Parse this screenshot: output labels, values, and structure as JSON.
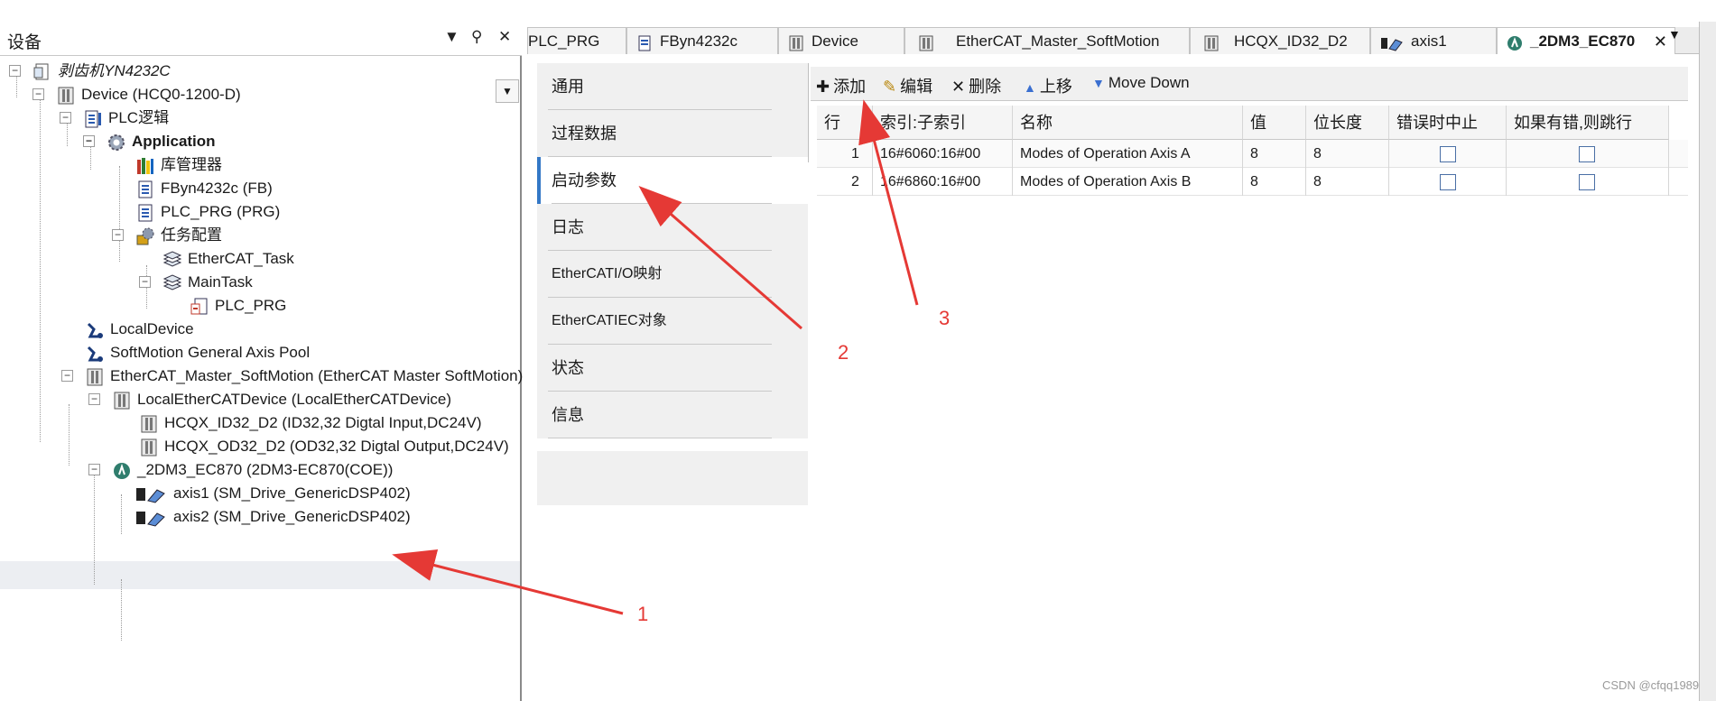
{
  "device_pane": {
    "title": "设备",
    "buttons": [
      "▼",
      "⚲",
      "✕"
    ],
    "tree": [
      {
        "label": "剥齿机YN4232C",
        "icon": "project-icon"
      },
      {
        "label": "Device (HCQ0-1200-D)",
        "icon": "device-icon"
      },
      {
        "label": "PLC逻辑",
        "icon": "plc-logic-icon"
      },
      {
        "label": "Application",
        "icon": "application-gear-icon"
      },
      {
        "label": "库管理器",
        "icon": "library-manager-icon"
      },
      {
        "label": "FByn4232c (FB)",
        "icon": "pou-icon"
      },
      {
        "label": "PLC_PRG (PRG)",
        "icon": "pou-icon"
      },
      {
        "label": "任务配置",
        "icon": "task-config-icon"
      },
      {
        "label": "EtherCAT_Task",
        "icon": "task-icon"
      },
      {
        "label": "MainTask",
        "icon": "task-icon"
      },
      {
        "label": "PLC_PRG",
        "icon": "program-call-icon"
      },
      {
        "label": "LocalDevice",
        "icon": "local-device-icon"
      },
      {
        "label": "SoftMotion General Axis Pool",
        "icon": "axis-pool-icon"
      },
      {
        "label": "EtherCAT_Master_SoftMotion (EtherCAT Master SoftMotion)",
        "icon": "device-icon"
      },
      {
        "label": "LocalEtherCATDevice (LocalEtherCATDevice)",
        "icon": "device-icon"
      },
      {
        "label": "HCQX_ID32_D2 (ID32,32 Digtal Input,DC24V)",
        "icon": "device-icon"
      },
      {
        "label": "HCQX_OD32_D2 (OD32,32 Digtal Output,DC24V)",
        "icon": "device-icon"
      },
      {
        "label": "_2DM3_EC870 (2DM3-EC870(COE))",
        "icon": "drive-icon"
      },
      {
        "label": "axis1 (SM_Drive_GenericDSP402)",
        "icon": "axis-icon"
      },
      {
        "label": "axis2 (SM_Drive_GenericDSP402)",
        "icon": "axis-icon"
      }
    ]
  },
  "tabs": [
    {
      "label": "PLC_PRG"
    },
    {
      "label": "FByn4232c"
    },
    {
      "label": "Device"
    },
    {
      "label": "EtherCAT_Master_SoftMotion"
    },
    {
      "label": "HCQX_ID32_D2"
    },
    {
      "label": "axis1"
    },
    {
      "label": "_2DM3_EC870"
    }
  ],
  "editor_tabs": [
    "通用",
    "过程数据",
    "启动参数",
    "日志",
    "EtherCATI/O映射",
    "EtherCATIEC对象",
    "状态",
    "信息"
  ],
  "toolbar": {
    "add": "添加",
    "edit": "编辑",
    "delete": "删除",
    "up": "上移",
    "down": "Move Down"
  },
  "grid": {
    "headers": [
      "行",
      "索引:子索引",
      "名称",
      "值",
      "位长度",
      "错误时中止",
      "如果有错,则跳行"
    ],
    "rows": [
      {
        "row": "1",
        "index": "16#6060:16#00",
        "name": "Modes of Operation Axis A",
        "value": "8",
        "bitlen": "8"
      },
      {
        "row": "2",
        "index": "16#6860:16#00",
        "name": "Modes of Operation Axis B",
        "value": "8",
        "bitlen": "8"
      }
    ]
  },
  "annotations": [
    "1",
    "2",
    "3"
  ],
  "annotation_color": "#e53935",
  "watermark": "CSDN @cfqq1989"
}
